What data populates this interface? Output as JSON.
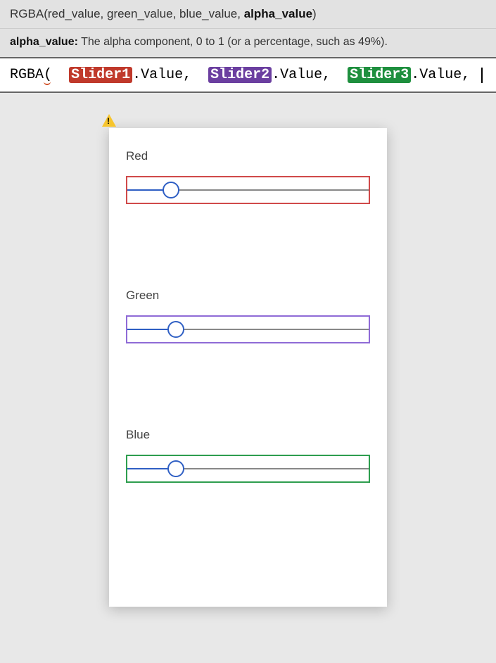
{
  "signature": {
    "fn": "RGBA",
    "param1": "red_value",
    "param2": "green_value",
    "param3": "blue_value",
    "param_active": "alpha_value"
  },
  "hint": {
    "label": "alpha_value:",
    "text": "The alpha component, 0 to 1 (or a percentage, such as 49%)."
  },
  "formula": {
    "fn": "RGBA",
    "open": "(",
    "slider1": "Slider1",
    "slider2": "Slider2",
    "slider3": "Slider3",
    "prop": ".Value",
    "comma": ","
  },
  "sliders": [
    {
      "label": "Red",
      "percent": 18,
      "box": "box-red"
    },
    {
      "label": "Green",
      "percent": 20,
      "box": "box-purple"
    },
    {
      "label": "Blue",
      "percent": 20,
      "box": "box-green"
    }
  ]
}
